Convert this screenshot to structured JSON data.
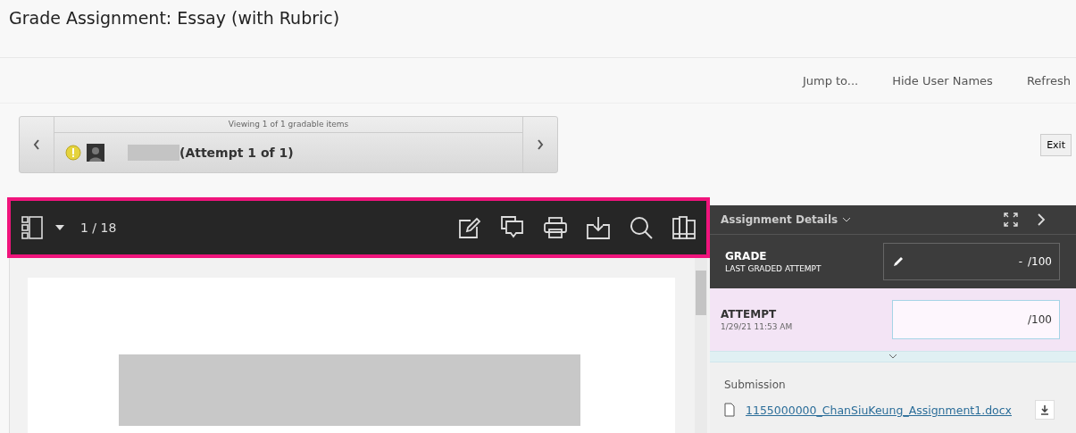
{
  "title": "Grade Assignment: Essay (with Rubric)",
  "actions": [
    "Jump to...",
    "Hide User Names",
    "Refresh"
  ],
  "navigator": {
    "caption": "Viewing 1 of 1 gradable items",
    "attempt": "(Attempt 1 of 1)",
    "needs_grading": true
  },
  "exit_button": "Exit",
  "viewer": {
    "page_counter": "1 / 18",
    "tools": [
      {
        "kind": "annotate"
      },
      {
        "kind": "comments"
      },
      {
        "kind": "print"
      },
      {
        "kind": "download"
      },
      {
        "kind": "search"
      },
      {
        "kind": "panels"
      }
    ]
  },
  "details": {
    "title": "Assignment Details",
    "grade": {
      "label": "GRADE",
      "sublabel": "LAST GRADED ATTEMPT",
      "value": "-",
      "max": "/100"
    },
    "attempt": {
      "label": "ATTEMPT",
      "date": "1/29/21 11:53 AM",
      "max": "/100"
    },
    "submission": {
      "label": "Submission",
      "file": "1155000000_ChanSiuKeung_Assignment1.docx"
    }
  }
}
